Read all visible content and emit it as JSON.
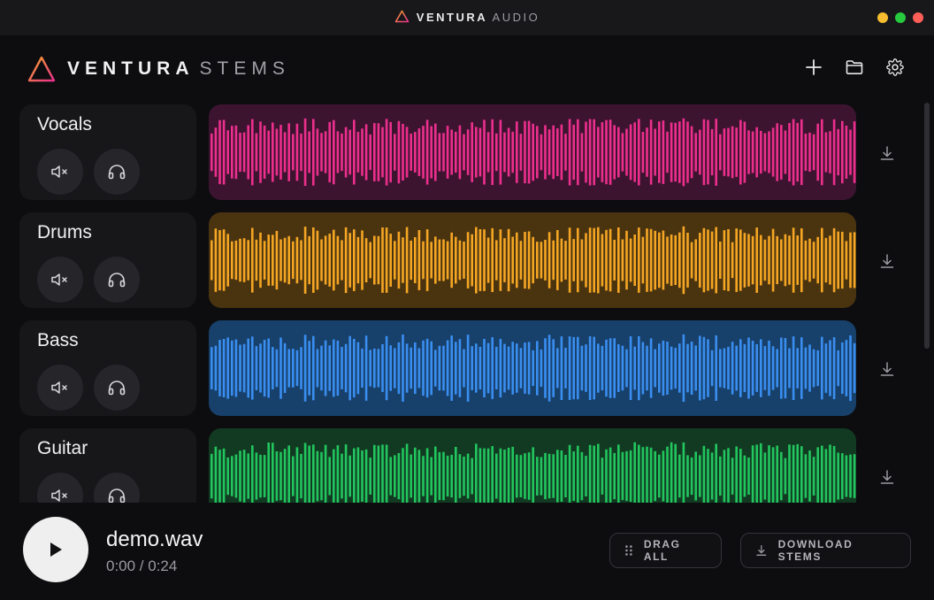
{
  "window": {
    "brand_bold": "VENTURA",
    "brand_light": "AUDIO",
    "controls": [
      {
        "name": "minimize",
        "color": "#f5bd2f"
      },
      {
        "name": "maximize",
        "color": "#27c93f"
      },
      {
        "name": "close",
        "color": "#ff5f57"
      }
    ]
  },
  "header": {
    "logo_bold": "VENTURA",
    "logo_light": "STEMS",
    "actions": [
      "plus-icon",
      "folder-icon",
      "gear-icon"
    ]
  },
  "tracks": [
    {
      "name": "Vocals",
      "color": "#ec2f8d",
      "bg": "#3d1430"
    },
    {
      "name": "Drums",
      "color": "#f5a623",
      "bg": "#4a3410"
    },
    {
      "name": "Bass",
      "color": "#3a8ef0",
      "bg": "#17406a"
    },
    {
      "name": "Guitar",
      "color": "#22c55e",
      "bg": "#123a22"
    }
  ],
  "player": {
    "file_name": "demo.wav",
    "time": "0:00 / 0:24",
    "drag_all_label": "DRAG ALL",
    "download_label": "DOWNLOAD STEMS"
  }
}
